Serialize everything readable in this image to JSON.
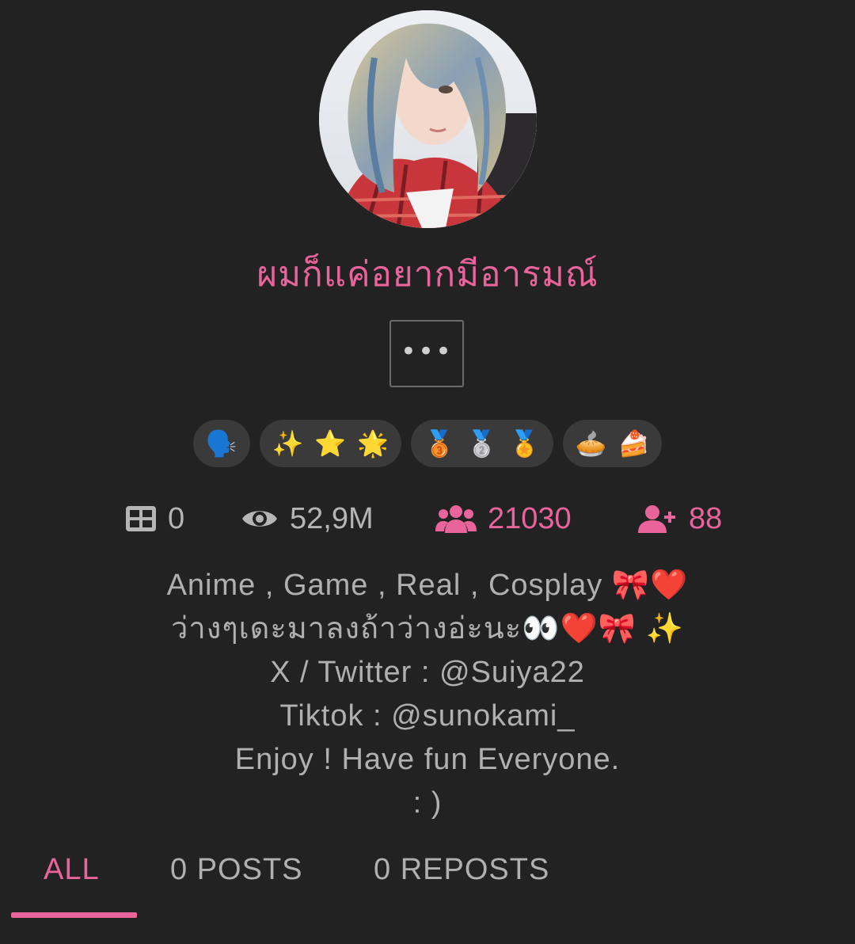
{
  "profile": {
    "username": "ผมก็แค่อยากมีอารมณ์",
    "more_button_label": "•••"
  },
  "badges": [
    {
      "emojis": [
        "🗣️"
      ]
    },
    {
      "emojis": [
        "✨",
        "⭐",
        "🌟"
      ]
    },
    {
      "emojis": [
        "🥉",
        "🥈",
        "🏅"
      ]
    },
    {
      "emojis": [
        "🥧",
        "🍰"
      ]
    }
  ],
  "stats": {
    "posts": "0",
    "views": "52,9M",
    "followers": "21030",
    "following": "88"
  },
  "bio": {
    "lines": [
      "Anime , Game , Real , Cosplay 🎀❤️",
      "ว่างๆเดะมาลงถ้าว่างอ่ะนะ👀❤️🎀 ✨",
      "X / Twitter : @Suiya22",
      "Tiktok : @sunokami_",
      "Enjoy ! Have fun Everyone.",
      ": )"
    ]
  },
  "tabs": {
    "all": "ALL",
    "posts": "0 POSTS",
    "reposts": "0 REPOSTS",
    "active": "all"
  },
  "colors": {
    "background": "#232223",
    "accent": "#e8649a",
    "text": "#b0b0b0",
    "badge_bg": "#3b3a3b"
  }
}
